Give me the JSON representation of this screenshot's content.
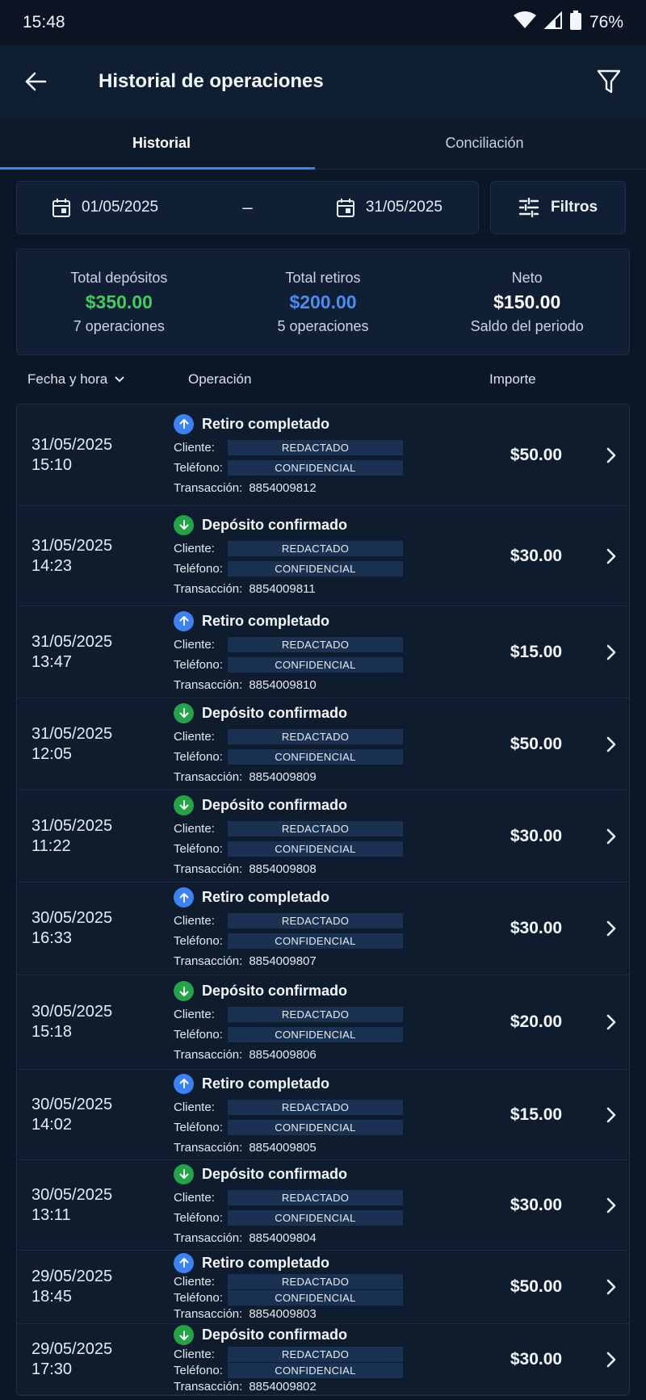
{
  "status": {
    "time": "15:48",
    "battery": "76%"
  },
  "appbar": {
    "title": "Historial de operaciones",
    "back_icon": "arrow-left-icon",
    "filter_icon": "funnel-icon"
  },
  "tabs": [
    {
      "label": "Historial",
      "active": true
    },
    {
      "label": "Conciliación",
      "active": false
    }
  ],
  "daterange": {
    "from": "01/05/2025",
    "separator": "–",
    "to": "31/05/2025"
  },
  "filters": {
    "label": "Filtros"
  },
  "summary": {
    "deposits": {
      "label": "Total depósitos",
      "amount": "$350.00",
      "sub": "7 operaciones",
      "color": "#3ecf5a"
    },
    "withdrawals": {
      "label": "Total retiros",
      "amount": "$200.00",
      "sub": "5 operaciones",
      "color": "#4a8df0"
    },
    "net": {
      "label": "Neto",
      "amount": "$150.00",
      "sub": "Saldo del periodo",
      "color": "#ffffff"
    }
  },
  "columns": {
    "date": "Fecha y hora",
    "operation": "Operación",
    "amount": "Importe"
  },
  "labels": {
    "client": "Cliente:",
    "phone": "Teléfono:",
    "transaction": "Transacción:"
  },
  "rows": [
    {
      "date": "31/05/2025",
      "time": "15:10",
      "type": "Retiro completado",
      "kind": "up",
      "client": "REDACTADO",
      "phone": "CONFIDENCIAL",
      "txn": "8854009812",
      "amount": "$50.00"
    },
    {
      "date": "31/05/2025",
      "time": "14:23",
      "type": "Depósito confirmado",
      "kind": "down",
      "client": "REDACTADO",
      "phone": "CONFIDENCIAL",
      "txn": "8854009811",
      "amount": "$30.00"
    },
    {
      "date": "31/05/2025",
      "time": "13:47",
      "type": "Retiro completado",
      "kind": "up",
      "client": "REDACTADO",
      "phone": "CONFIDENCIAL",
      "txn": "8854009810",
      "amount": "$15.00"
    },
    {
      "date": "31/05/2025",
      "time": "12:05",
      "type": "Depósito confirmado",
      "kind": "down",
      "client": "REDACTADO",
      "phone": "CONFIDENCIAL",
      "txn": "8854009809",
      "amount": "$50.00"
    },
    {
      "date": "31/05/2025",
      "time": "11:22",
      "type": "Depósito confirmado",
      "kind": "down",
      "client": "REDACTADO",
      "phone": "CONFIDENCIAL",
      "txn": "8854009808",
      "amount": "$30.00"
    },
    {
      "date": "30/05/2025",
      "time": "16:33",
      "type": "Retiro completado",
      "kind": "up",
      "client": "REDACTADO",
      "phone": "CONFIDENCIAL",
      "txn": "8854009807",
      "amount": "$30.00"
    },
    {
      "date": "30/05/2025",
      "time": "15:18",
      "type": "Depósito confirmado",
      "kind": "down",
      "client": "REDACTADO",
      "phone": "CONFIDENCIAL",
      "txn": "8854009806",
      "amount": "$20.00"
    },
    {
      "date": "30/05/2025",
      "time": "14:02",
      "type": "Retiro completado",
      "kind": "up",
      "client": "REDACTADO",
      "phone": "CONFIDENCIAL",
      "txn": "8854009805",
      "amount": "$15.00"
    },
    {
      "date": "30/05/2025",
      "time": "13:11",
      "type": "Depósito confirmado",
      "kind": "down",
      "client": "REDACTADO",
      "phone": "CONFIDENCIAL",
      "txn": "8854009804",
      "amount": "$30.00"
    },
    {
      "date": "29/05/2025",
      "time": "18:45",
      "type": "Retiro completado",
      "kind": "up",
      "client": "REDACTADO",
      "phone": "CONFIDENCIAL",
      "txn": "8854009803",
      "amount": "$50.00"
    },
    {
      "date": "29/05/2025",
      "time": "17:30",
      "type": "Depósito confirmado",
      "kind": "down",
      "client": "REDACTADO",
      "phone": "CONFIDENCIAL",
      "txn": "8854009802",
      "amount": "$30.00"
    }
  ]
}
